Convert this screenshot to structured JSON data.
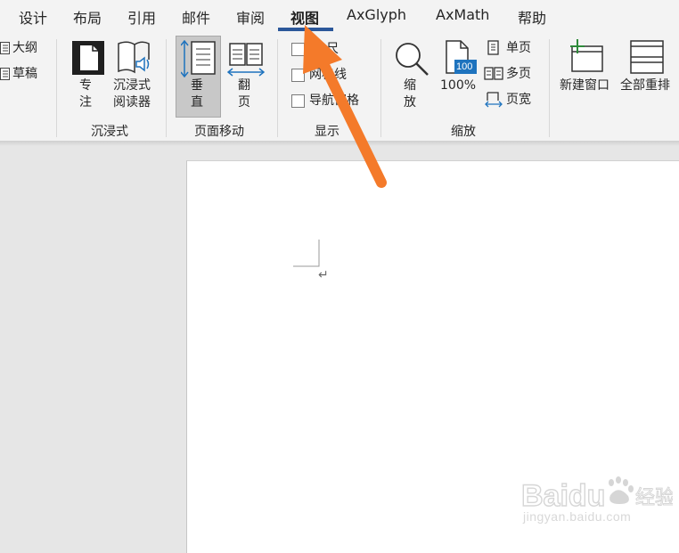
{
  "tabs": [
    {
      "label": "设计"
    },
    {
      "label": "布局"
    },
    {
      "label": "引用"
    },
    {
      "label": "邮件"
    },
    {
      "label": "审阅"
    },
    {
      "label": "视图",
      "active": true
    },
    {
      "label": "AxGlyph"
    },
    {
      "label": "AxMath"
    },
    {
      "label": "帮助"
    }
  ],
  "views": {
    "outline_label": "大纲",
    "draft_label": "草稿"
  },
  "immersive": {
    "group_label": "沉浸式",
    "focus_line1": "专",
    "focus_line2": "注",
    "reader_line1": "沉浸式",
    "reader_line2": "阅读器"
  },
  "page_movement": {
    "group_label": "页面移动",
    "vertical_line1": "垂",
    "vertical_line2": "直",
    "side_line1": "翻",
    "side_line2": "页"
  },
  "show": {
    "group_label": "显示",
    "ruler_label": "尺",
    "gridlines_label": "网格线",
    "navpane_label": "导航窗格"
  },
  "zoom": {
    "group_label": "缩放",
    "zoom_line1": "缩",
    "zoom_line2": "放",
    "hundred_label": "100%",
    "hundred_badge": "100",
    "one_page_label": "单页",
    "multi_page_label": "多页",
    "page_width_label": "页宽"
  },
  "window": {
    "new_window_label": "新建窗口",
    "arrange_all_label": "全部重排"
  },
  "document": {
    "paragraph_mark": "↵"
  },
  "watermark": {
    "brand": "Baidu",
    "product": "经验",
    "url": "jingyan.baidu.com"
  },
  "colors": {
    "ribbon_bg": "#f3f3f3",
    "accent": "#2b579a",
    "arrow": "#f47a2a",
    "workspace": "#e6e6e6",
    "icon_blue": "#1e73be",
    "icon_green": "#2e8b3a"
  }
}
